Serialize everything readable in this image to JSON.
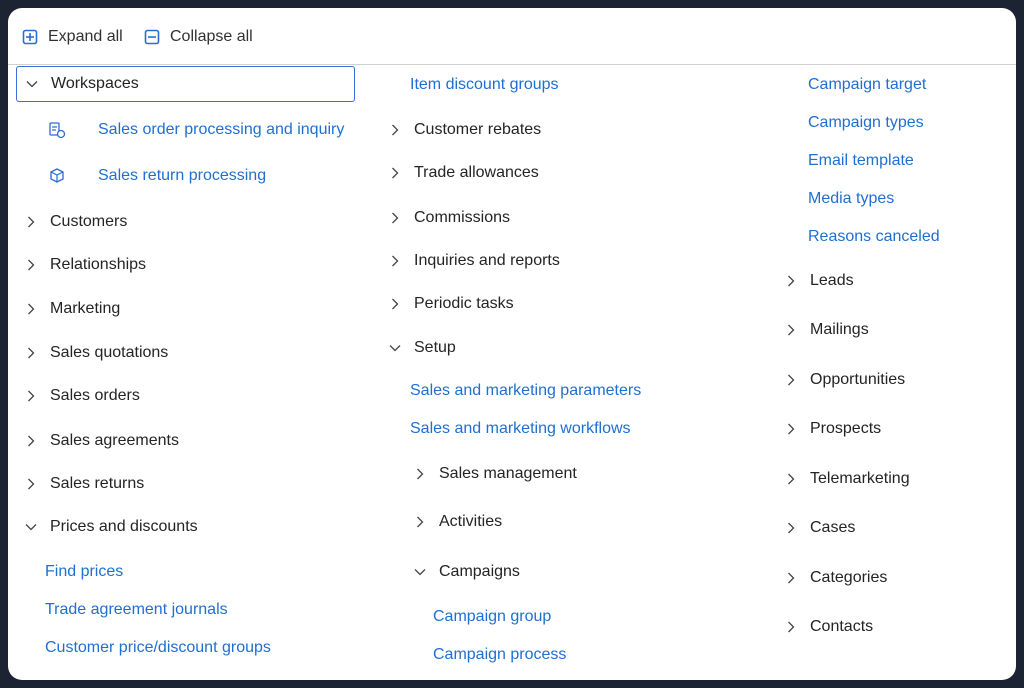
{
  "toolbar": {
    "expand_all": "Expand all",
    "collapse_all": "Collapse all"
  },
  "col1": {
    "workspaces": "Workspaces",
    "ws_items": [
      "Sales order processing and inquiry",
      "Sales return processing"
    ],
    "nodes": [
      "Customers",
      "Relationships",
      "Marketing",
      "Sales quotations",
      "Sales orders",
      "Sales agreements",
      "Sales returns"
    ],
    "prices": "Prices and discounts",
    "price_leaves": [
      "Find prices",
      "Trade agreement journals",
      "Customer price/discount groups"
    ]
  },
  "col2": {
    "item_discount": "Item discount groups",
    "nodes": [
      "Customer rebates",
      "Trade allowances",
      "Commissions",
      "Inquiries and reports",
      "Periodic tasks"
    ],
    "setup": "Setup",
    "setup_leaves": [
      "Sales and marketing parameters",
      "Sales and marketing workflows"
    ],
    "sub_nodes": [
      "Sales management",
      "Activities"
    ],
    "campaigns": "Campaigns",
    "campaign_leaves": [
      "Campaign group",
      "Campaign process"
    ]
  },
  "col3": {
    "campaign_leaves": [
      "Campaign target",
      "Campaign types",
      "Email template",
      "Media types",
      "Reasons canceled"
    ],
    "nodes": [
      "Leads",
      "Mailings",
      "Opportunities",
      "Prospects",
      "Telemarketing",
      "Cases",
      "Categories",
      "Contacts"
    ]
  },
  "colors": {
    "link": "#1f6fd1",
    "text": "#242424",
    "accent": "#3a6fd8"
  }
}
